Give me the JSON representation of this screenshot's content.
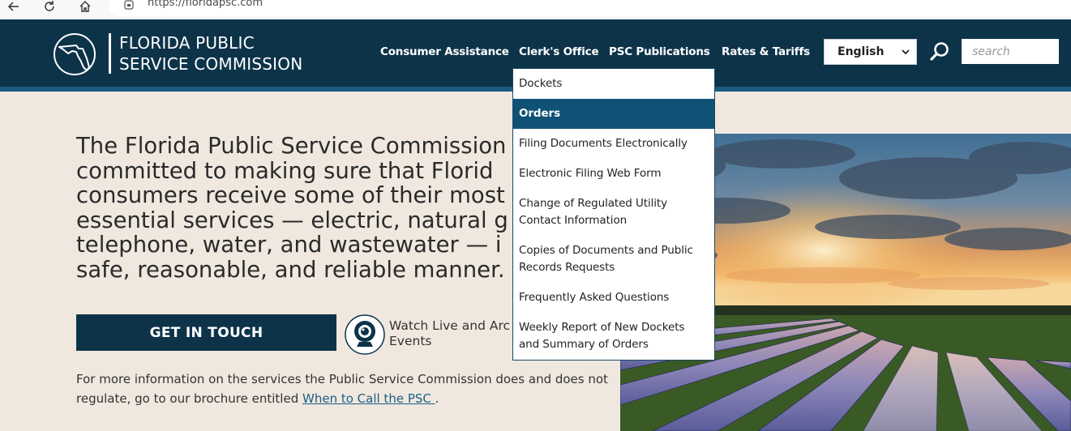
{
  "browser": {
    "url": "https://floridapsc.com",
    "icons": [
      "back-arrow-icon",
      "reload-icon",
      "home-icon",
      "site-info-icon"
    ]
  },
  "header": {
    "title_line1": "FLORIDA PUBLIC",
    "title_line2": "SERVICE COMMISSION",
    "logo_icon": "florida-map-seal-icon",
    "nav": [
      {
        "label": "Consumer Assistance"
      },
      {
        "label": "Clerk's Office"
      },
      {
        "label": "PSC Publications"
      },
      {
        "label": "Rates & Tariffs"
      }
    ],
    "language": {
      "selected": "English"
    },
    "search": {
      "placeholder": "search",
      "icon": "magnifier-icon"
    }
  },
  "dropdown": {
    "parent": "Clerk's Office",
    "items": [
      {
        "line1": "Dockets",
        "line2": ""
      },
      {
        "line1": "Orders",
        "line2": ""
      },
      {
        "line1": "Filing Documents Electronically",
        "line2": ""
      },
      {
        "line1": "Electronic Filing Web Form",
        "line2": ""
      },
      {
        "line1": "Change of Regulated Utility",
        "line2": "Contact Information"
      },
      {
        "line1": "Copies of Documents and Public",
        "line2": "Records Requests"
      },
      {
        "line1": "Frequently Asked Questions",
        "line2": ""
      },
      {
        "line1": "Weekly Report of New Dockets",
        "line2": "and Summary of Orders"
      }
    ],
    "active_index": 1
  },
  "hero": {
    "lines": [
      "The Florida Public Service Commission",
      "committed to making sure that Florid",
      "consumers receive some of their most",
      "essential services — electric, natural g",
      "telephone, water, and wastewater — i",
      "safe, reasonable, and reliable manner."
    ],
    "cta_label": "GET IN TOUCH",
    "watch_line1": "Watch Live and Arc",
    "watch_line2": "Events",
    "info_prefix": "For more information on the services the Public Service Commission does and does not regulate, go to our brochure entitled ",
    "info_link": "When to Call the PSC ",
    "info_suffix": "."
  },
  "colors": {
    "header_bg": "#0d3349",
    "header_stripe": "#195a82",
    "page_bg": "#f0e8df",
    "active_menu": "#0f5276",
    "link": "#1b5f86"
  }
}
